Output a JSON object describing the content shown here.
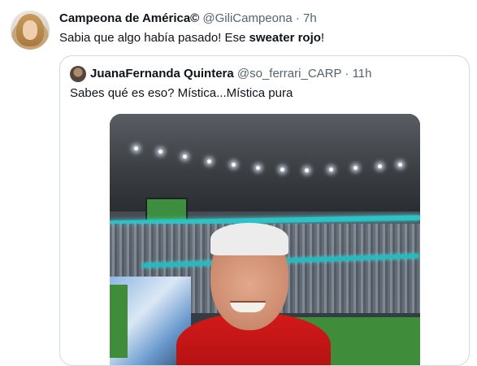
{
  "tweet": {
    "author_name": "Campeona de América©",
    "author_handle": "@GiliCampeona",
    "separator": "·",
    "time": "7h",
    "text_before": "Sabia que algo había pasado! Ese ",
    "text_bold": "sweater rojo",
    "text_after": "!"
  },
  "quoted": {
    "author_name": "JuanaFernanda Quintera",
    "author_handle": "@so_ferrari_CARP",
    "separator": "·",
    "time": "11h",
    "text": "Sabes qué es eso? Mística...Mística pura"
  }
}
